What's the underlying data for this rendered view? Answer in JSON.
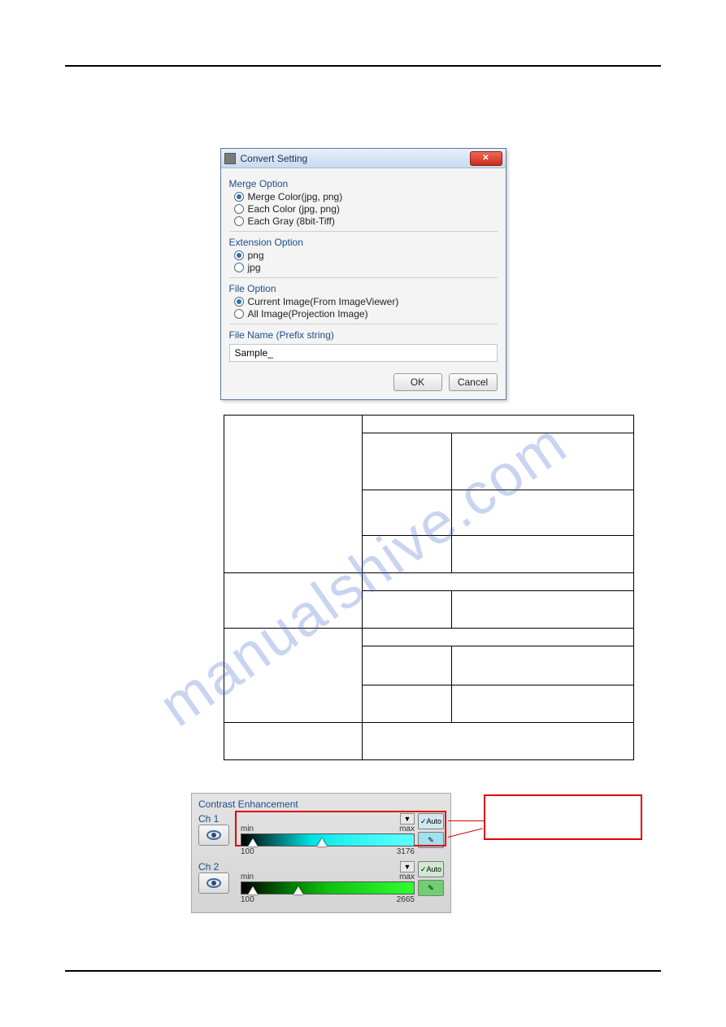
{
  "watermark": "manualshive.com",
  "dialog": {
    "title": "Convert Setting",
    "close_glyph": "✕",
    "merge_option": {
      "label": "Merge Option",
      "items": [
        {
          "label": "Merge Color(jpg, png)",
          "selected": true
        },
        {
          "label": "Each Color (jpg, png)",
          "selected": false
        },
        {
          "label": "Each Gray  (8bit-Tiff)",
          "selected": false
        }
      ]
    },
    "extension_option": {
      "label": "Extension Option",
      "items": [
        {
          "label": "png",
          "selected": true
        },
        {
          "label": "jpg",
          "selected": false
        }
      ]
    },
    "file_option": {
      "label": "File Option",
      "items": [
        {
          "label": "Current Image(From ImageViewer)",
          "selected": true
        },
        {
          "label": "All Image(Projection Image)",
          "selected": false
        }
      ]
    },
    "file_name_label": "File Name (Prefix string)",
    "file_name_value": "Sample_",
    "ok": "OK",
    "cancel": "Cancel"
  },
  "contrast_panel": {
    "title": "Contrast Enhancement",
    "channels": [
      {
        "name": "Ch 1",
        "min_label": "min",
        "max_label": "max",
        "min_value": "100",
        "max_value": "3176",
        "auto_label": "Auto",
        "color": "cyan",
        "tri_left_pct": 4,
        "tri_right_pct": 44
      },
      {
        "name": "Ch 2",
        "min_label": "min",
        "max_label": "max",
        "min_value": "100",
        "max_value": "2665",
        "auto_label": "Auto",
        "color": "green",
        "tri_left_pct": 4,
        "tri_right_pct": 30
      }
    ],
    "dropdown_glyph": "▼"
  }
}
